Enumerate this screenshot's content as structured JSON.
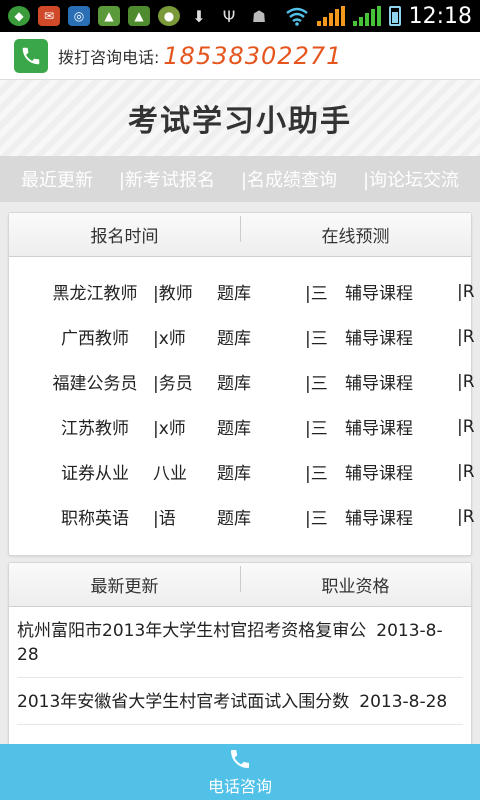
{
  "status_bar": {
    "time": "12:18",
    "icons": [
      "app-icon-1",
      "notification-icon",
      "sync-icon",
      "android-icon",
      "android-icon-2",
      "app-icon-2",
      "download-icon",
      "usb-icon",
      "android-icon-3",
      "wifi-icon",
      "signal-icon",
      "signal-icon-2",
      "battery-icon"
    ]
  },
  "header": {
    "phone_label": "拨打咨询电话:",
    "phone_number": "18538302271",
    "accent_color": "#e5561e",
    "phone_icon": "phone-icon"
  },
  "title": "考试学习小助手",
  "nav": {
    "items": [
      "最近更新",
      "|新考试报名",
      "|名成绩查询",
      "|询论坛交流"
    ]
  },
  "card1": {
    "tabs": [
      "报名时间",
      "在线预测"
    ],
    "rows": [
      {
        "name": "黑龙江教师",
        "short": "|教师",
        "bank": "题库",
        "sep1": "|三",
        "course": "辅导课程",
        "sep2": "|R"
      },
      {
        "name": "广西教师",
        "short": "|x师",
        "bank": "题库",
        "sep1": "|三",
        "course": "辅导课程",
        "sep2": "|R"
      },
      {
        "name": "福建公务员",
        "short": "|务员",
        "bank": "题库",
        "sep1": "|三",
        "course": "辅导课程",
        "sep2": "|R"
      },
      {
        "name": "江苏教师",
        "short": "|x师",
        "bank": "题库",
        "sep1": "|三",
        "course": "辅导课程",
        "sep2": "|R"
      },
      {
        "name": "证券从业",
        "short": "八业",
        "bank": "题库",
        "sep1": "|三",
        "course": "辅导课程",
        "sep2": "|R"
      },
      {
        "name": "职称英语",
        "short": "|语",
        "bank": "题库",
        "sep1": "|三",
        "course": "辅导课程",
        "sep2": "|R"
      }
    ]
  },
  "card2": {
    "tabs": [
      "最新更新",
      "职业资格"
    ],
    "news": [
      {
        "text": "杭州富阳市2013年大学生村官招考资格复审公",
        "date": "2013-8-28"
      },
      {
        "text": "2013年安徽省大学生村官考试面试入围分数",
        "date": "2013-8-28"
      }
    ]
  },
  "bottom": {
    "call_label": "电话咨询",
    "bar_color": "#52c1e8"
  }
}
